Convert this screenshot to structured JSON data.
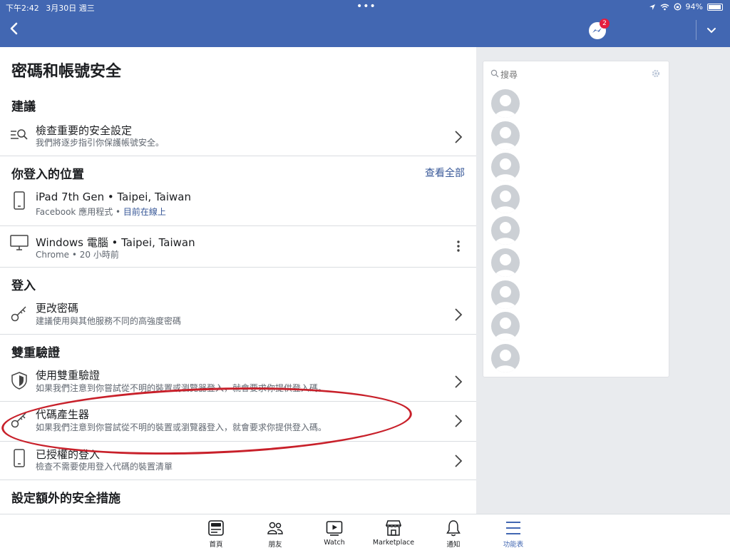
{
  "status": {
    "time": "下午2:42",
    "date": "3月30日 週三",
    "battery": "94%",
    "battery_level": 0.94
  },
  "nav": {
    "messenger_badge": "2"
  },
  "page": {
    "title": "密碼和帳號安全"
  },
  "sections": {
    "suggest": {
      "title": "建議"
    },
    "where": {
      "title": "你登入的位置",
      "see_all": "查看全部"
    },
    "login": {
      "title": "登入"
    },
    "twofa": {
      "title": "雙重驗證"
    },
    "extra": {
      "title": "設定額外的安全措施"
    }
  },
  "rows": {
    "check": {
      "title": "檢查重要的安全設定",
      "sub": "我們將逐步指引你保護帳號安全。"
    },
    "ipad": {
      "title": "iPad 7th Gen • Taipei, Taiwan",
      "sub_app": "Facebook 應用程式 • ",
      "sub_online": "目前在線上"
    },
    "windows": {
      "title": "Windows 電腦 • Taipei, Taiwan",
      "sub": "Chrome • 20 小時前"
    },
    "password": {
      "title": "更改密碼",
      "sub": "建議使用與其他服務不同的高強度密碼"
    },
    "use2fa": {
      "title": "使用雙重驗證",
      "sub": "如果我們注意到你嘗試從不明的裝置或瀏覽器登入，就會要求你提供登入碼。"
    },
    "codegen": {
      "title": "代碼產生器",
      "sub": "如果我們注意到你嘗試從不明的裝置或瀏覽器登入，就會要求你提供登入碼。"
    },
    "authorized": {
      "title": "已授權的登入",
      "sub": "檢查不需要使用登入代碼的裝置清單"
    }
  },
  "sidebar": {
    "search_placeholder": "搜尋"
  },
  "tabs": [
    "首頁",
    "朋友",
    "Watch",
    "Marketplace",
    "通知",
    "功能表"
  ],
  "colors": {
    "brand": "#4267b2",
    "link": "#385898",
    "annotation": "#c8202a"
  }
}
